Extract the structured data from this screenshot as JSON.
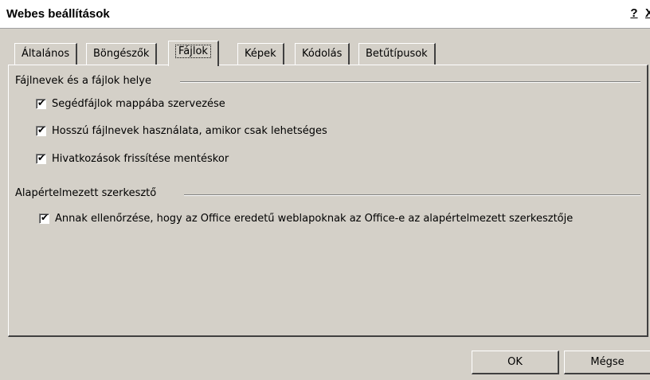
{
  "window": {
    "title": "Webes beállítások",
    "help_button": "?",
    "close_button": "X"
  },
  "tabs": [
    {
      "label": "Általános",
      "active": false
    },
    {
      "label": "Böngészők",
      "active": false
    },
    {
      "label": "Fájlok",
      "active": true
    },
    {
      "label": "Képek",
      "active": false
    },
    {
      "label": "Kódolás",
      "active": false
    },
    {
      "label": "Betűtípusok",
      "active": false
    }
  ],
  "file_group": {
    "title": "Fájlnevek és a fájlok helye",
    "options": [
      {
        "label": "Segédfájlok mappába szervezése",
        "checked": true
      },
      {
        "label": "Hosszú fájlnevek használata, amikor csak lehetséges",
        "checked": true
      },
      {
        "label": "Hivatkozások frissítése mentéskor",
        "checked": true
      }
    ]
  },
  "editor_group": {
    "title": "Alapértelmezett szerkesztő",
    "options": [
      {
        "label": "Annak ellenőrzése, hogy az Office eredetű weblapoknak az Office-e az alapértelmezett szerkesztője",
        "checked": true
      }
    ]
  },
  "buttons": {
    "ok": "OK",
    "cancel": "Mégse"
  }
}
